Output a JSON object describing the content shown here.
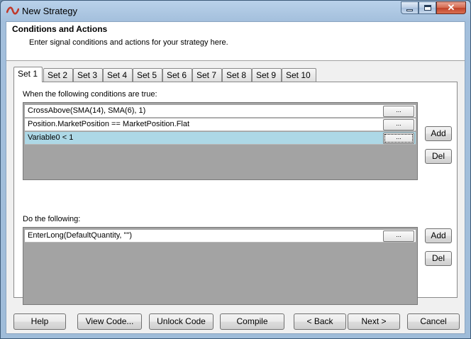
{
  "window": {
    "title": "New Strategy",
    "icon": "ninja-wave-icon"
  },
  "header": {
    "title": "Conditions and Actions",
    "subtitle": "Enter signal conditions and actions for your strategy here."
  },
  "tabs": [
    {
      "label": "Set 1",
      "active": true
    },
    {
      "label": "Set 2"
    },
    {
      "label": "Set 3"
    },
    {
      "label": "Set 4"
    },
    {
      "label": "Set 5"
    },
    {
      "label": "Set 6"
    },
    {
      "label": "Set 7"
    },
    {
      "label": "Set 8"
    },
    {
      "label": "Set 9"
    },
    {
      "label": "Set 10"
    }
  ],
  "conditions": {
    "label": "When the following conditions are true:",
    "rows": [
      {
        "text": "CrossAbove(SMA(14), SMA(6), 1)",
        "button": "..."
      },
      {
        "text": "Position.MarketPosition == MarketPosition.Flat",
        "button": "..."
      },
      {
        "text": "Variable0 < 1",
        "button": "...",
        "selected": true
      }
    ],
    "add_label": "Add",
    "del_label": "Del"
  },
  "actions": {
    "label": "Do the following:",
    "rows": [
      {
        "text": "EnterLong(DefaultQuantity, \"\")",
        "button": "..."
      }
    ],
    "add_label": "Add",
    "del_label": "Del"
  },
  "footer": {
    "help": "Help",
    "view_code": "View Code...",
    "unlock_code": "Unlock Code",
    "compile": "Compile",
    "back": "< Back",
    "next": "Next >",
    "cancel": "Cancel"
  },
  "colors": {
    "selected_row": "#add8e6",
    "grid_background": "#a3a3a3",
    "titlebar": "#a3bfdc"
  }
}
